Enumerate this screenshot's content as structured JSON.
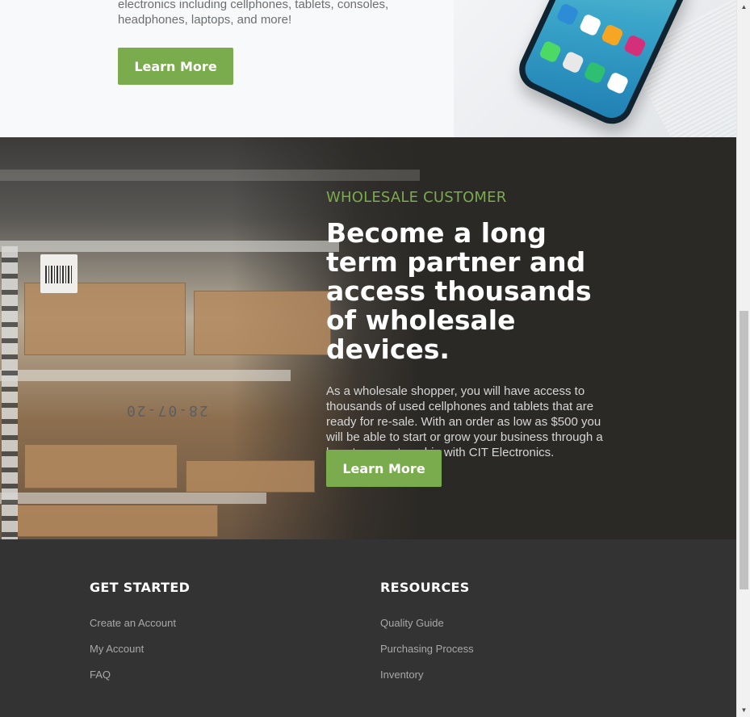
{
  "consumer": {
    "description": "electronics including cellphones, tablets, consoles, headphones, laptops, and more!",
    "button_label": "Learn More"
  },
  "wholesale": {
    "eyebrow": "WHOLESALE CUSTOMER",
    "headline_bold": "Become a long term partner",
    "headline_rest": " and access thousands of wholesale devices.",
    "body": "As a wholesale shopper, you will have access to thousands of used cellphones and tablets that are ready for re-sale. With an order as low as $500 you will be able to start or grow your business through a long term partnership with CIT Electronics.",
    "button_label": "Learn More",
    "rack_label": "28-07-20"
  },
  "footer": {
    "columns": [
      {
        "title": "GET STARTED",
        "links": [
          "Create an Account",
          "My Account",
          "FAQ"
        ]
      },
      {
        "title": "RESOURCES",
        "links": [
          "Quality Guide",
          "Purchasing Process",
          "Inventory"
        ]
      }
    ]
  },
  "icons": {
    "scroll_up": "scroll-up-arrow-icon",
    "scroll_down": "scroll-down-arrow-icon"
  },
  "colors": {
    "accent_green": "#7aab4c",
    "footer_bg": "#333333",
    "wholesale_bg": "#2b2926"
  }
}
